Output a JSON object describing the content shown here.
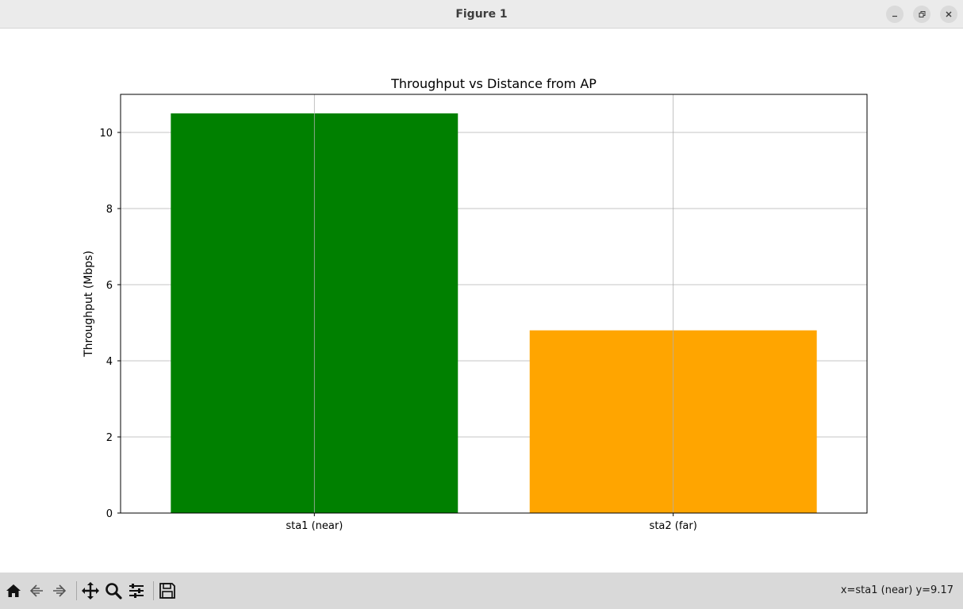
{
  "window": {
    "title": "Figure 1",
    "controls": [
      "minimize-icon",
      "restore-icon",
      "close-icon"
    ]
  },
  "toolbar": {
    "buttons": [
      "home-icon",
      "back-arrow-icon",
      "forward-arrow-icon",
      "pan-icon",
      "zoom-icon",
      "configure-subplots-icon",
      "save-icon"
    ],
    "coords": "x=sta1 (near) y=9.17"
  },
  "chart_data": {
    "type": "bar",
    "title": "Throughput vs Distance from AP",
    "xlabel": "",
    "ylabel": "Throughput (Mbps)",
    "categories": [
      "sta1 (near)",
      "sta2 (far)"
    ],
    "values": [
      10.5,
      4.8
    ],
    "colors": [
      "#008000",
      "#ffa500"
    ],
    "ylim": [
      0,
      11
    ],
    "yticks": [
      0,
      2,
      4,
      6,
      8,
      10
    ],
    "grid": true,
    "legend": false
  }
}
